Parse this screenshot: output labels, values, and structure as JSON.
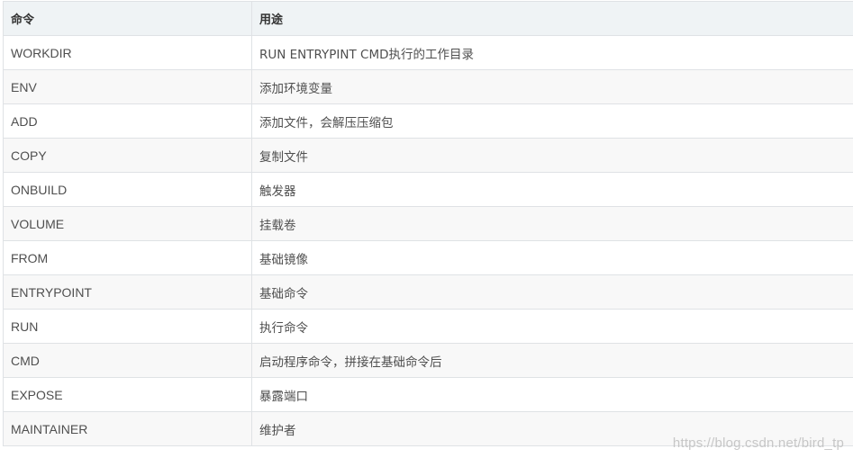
{
  "table": {
    "headers": [
      "命令",
      "用途"
    ],
    "rows": [
      [
        "WORKDIR",
        "RUN ENTRYPINT CMD执行的工作目录"
      ],
      [
        "ENV",
        "添加环境变量"
      ],
      [
        "ADD",
        "添加文件，会解压压缩包"
      ],
      [
        "COPY",
        "复制文件"
      ],
      [
        "ONBUILD",
        "触发器"
      ],
      [
        "VOLUME",
        "挂载卷"
      ],
      [
        "FROM",
        "基础镜像"
      ],
      [
        "ENTRYPOINT",
        "基础命令"
      ],
      [
        "RUN",
        "执行命令"
      ],
      [
        "CMD",
        "启动程序命令，拼接在基础命令后"
      ],
      [
        "EXPOSE",
        "暴露端口"
      ],
      [
        "MAINTAINER",
        "维护者"
      ]
    ]
  },
  "watermark": "https://blog.csdn.net/bird_tp"
}
